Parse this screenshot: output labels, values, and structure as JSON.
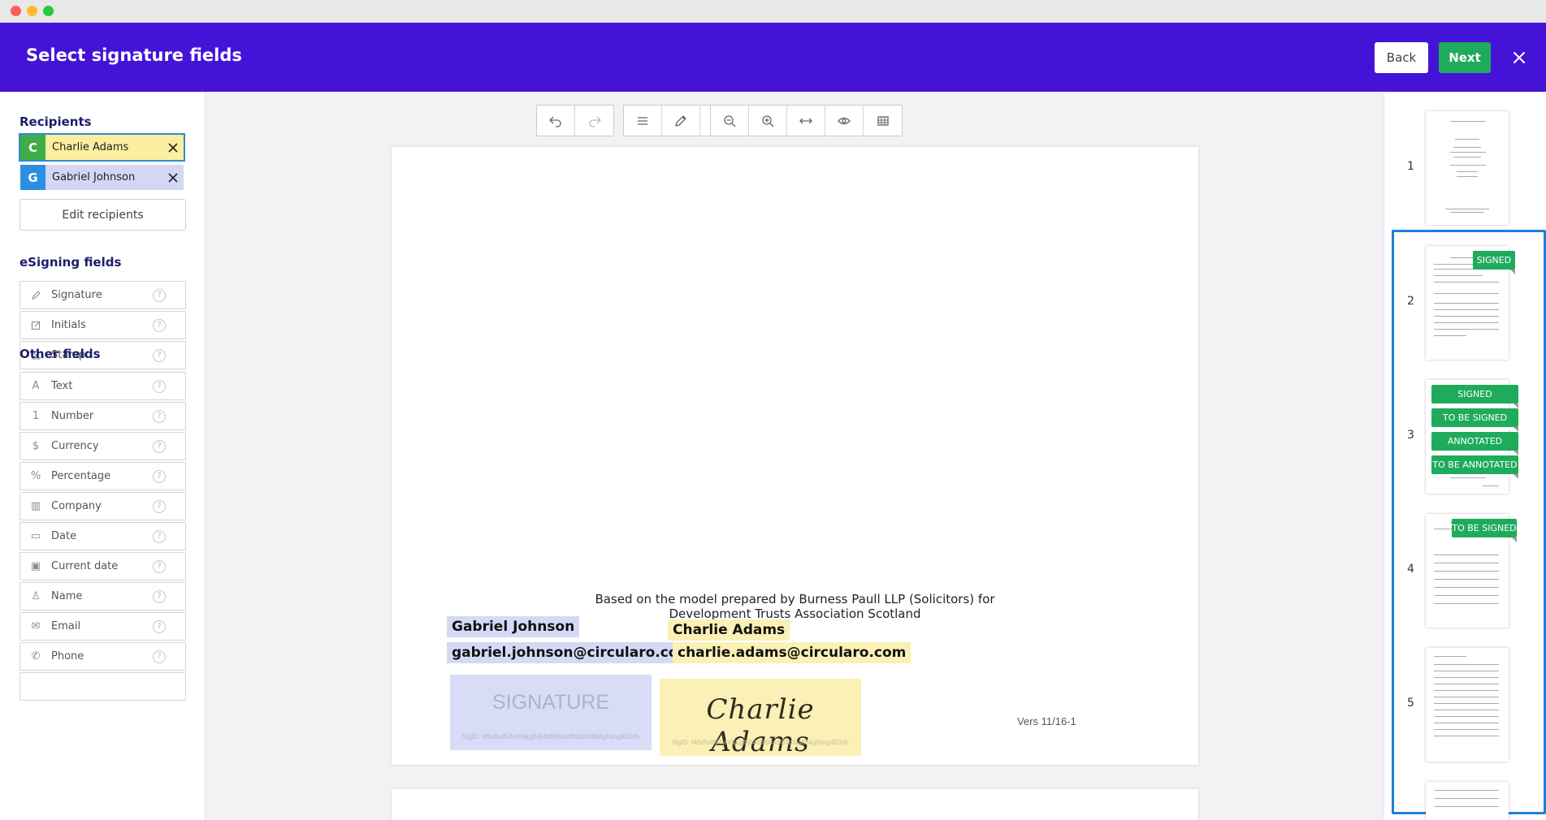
{
  "header": {
    "title": "Select signature fields",
    "back_label": "Back",
    "next_label": "Next"
  },
  "sidebar": {
    "recipients_title": "Recipients",
    "recipients": [
      {
        "initial": "C",
        "name": "Charlie Adams"
      },
      {
        "initial": "G",
        "name": "Gabriel Johnson"
      }
    ],
    "edit_recipients_label": "Edit recipients",
    "esigning_title": "eSigning fields",
    "esigning_fields": [
      {
        "label": "Signature",
        "icon": "pen-icon"
      },
      {
        "label": "Initials",
        "icon": "edit-icon"
      },
      {
        "label": "Stamp",
        "icon": "stamp-icon"
      }
    ],
    "other_title": "Other fields",
    "other_fields": [
      {
        "label": "Text",
        "icon": "text-icon",
        "glyph": "A"
      },
      {
        "label": "Number",
        "icon": "number-icon",
        "glyph": "1"
      },
      {
        "label": "Currency",
        "icon": "currency-icon",
        "glyph": "$"
      },
      {
        "label": "Percentage",
        "icon": "percent-icon",
        "glyph": "%"
      },
      {
        "label": "Company",
        "icon": "building-icon",
        "glyph": "▥"
      },
      {
        "label": "Date",
        "icon": "calendar-icon",
        "glyph": "▭"
      },
      {
        "label": "Current date",
        "icon": "calendar-check-icon",
        "glyph": "▣"
      },
      {
        "label": "Name",
        "icon": "person-icon",
        "glyph": "♙"
      },
      {
        "label": "Email",
        "icon": "envelope-icon",
        "glyph": "✉"
      },
      {
        "label": "Phone",
        "icon": "phone-icon",
        "glyph": "✆"
      }
    ]
  },
  "document": {
    "footer_line1": "Based on the model prepared by Burness Paull LLP (Solicitors) for",
    "footer_line2": "Development Trusts Association Scotland",
    "gabriel_name": "Gabriel Johnson",
    "gabriel_email": "gabriel.johnson@circularo.com",
    "charlie_name": "Charlie Adams",
    "charlie_email": "charlie.adams@circularo.com",
    "signature_placeholder": "SIGNATURE",
    "sig_id_gabriel": "SigID: f45dfsdf54vhf4jkgfhj54df894sdf81bfd4884ghbng453rth",
    "sig_id_charlie": "SigID: f45dfsdf54vhf4jkgfhj54df894sdf81bfd4884ghbng453rth",
    "charlie_signature": "Charlie Adams",
    "version": "Vers 11/16-1"
  },
  "thumbnails": [
    {
      "number": "1",
      "badges": []
    },
    {
      "number": "2",
      "badges": [
        "SIGNED"
      ]
    },
    {
      "number": "3",
      "badges": [
        "SIGNED",
        "TO BE SIGNED",
        "ANNOTATED",
        "TO BE ANNOTATED"
      ]
    },
    {
      "number": "4",
      "badges": [
        "TO BE SIGNED"
      ]
    },
    {
      "number": "5",
      "badges": []
    }
  ],
  "colors": {
    "header": "#4513d8",
    "accent_green": "#1fab5c",
    "selection_blue": "#1e7fd8",
    "recipient_charlie": "#fbee9e",
    "recipient_gabriel": "#d4d6f5"
  }
}
